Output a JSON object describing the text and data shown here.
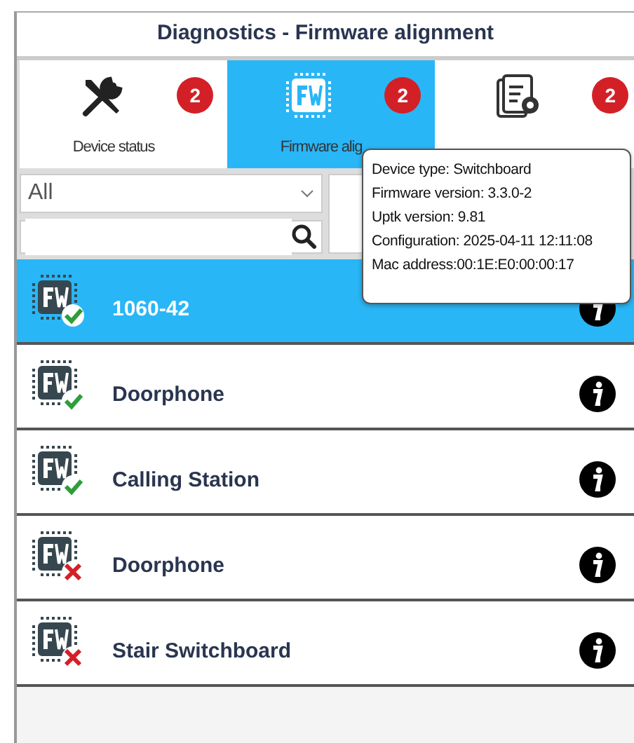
{
  "window": {
    "title": "Diagnostics - Firmware alignment"
  },
  "tabs": [
    {
      "label": "Device status",
      "kind": "tools",
      "badge": "2",
      "selected": false
    },
    {
      "label": "Firmware alig",
      "kind": "firmware",
      "badge": "2",
      "selected": true
    },
    {
      "kind": "config",
      "badge": "2",
      "selected": false
    }
  ],
  "filter": {
    "value": "All"
  },
  "devices": [
    {
      "name": "1060-42",
      "aligned": true,
      "selected": true
    },
    {
      "name": "Doorphone",
      "aligned": true,
      "selected": false
    },
    {
      "name": "Calling Station",
      "aligned": true,
      "selected": false
    },
    {
      "name": "Doorphone",
      "aligned": false,
      "selected": false
    },
    {
      "name": "Stair Switchboard",
      "aligned": false,
      "selected": false
    }
  ],
  "tooltip": {
    "lines": [
      "Device type: Switchboard",
      "Firmware version: 3.3.0-2",
      "Uptk version: 9.81",
      "Configuration: 2025-04-11 12:11:08",
      "Mac address:00:1E:E0:00:00:17"
    ]
  }
}
